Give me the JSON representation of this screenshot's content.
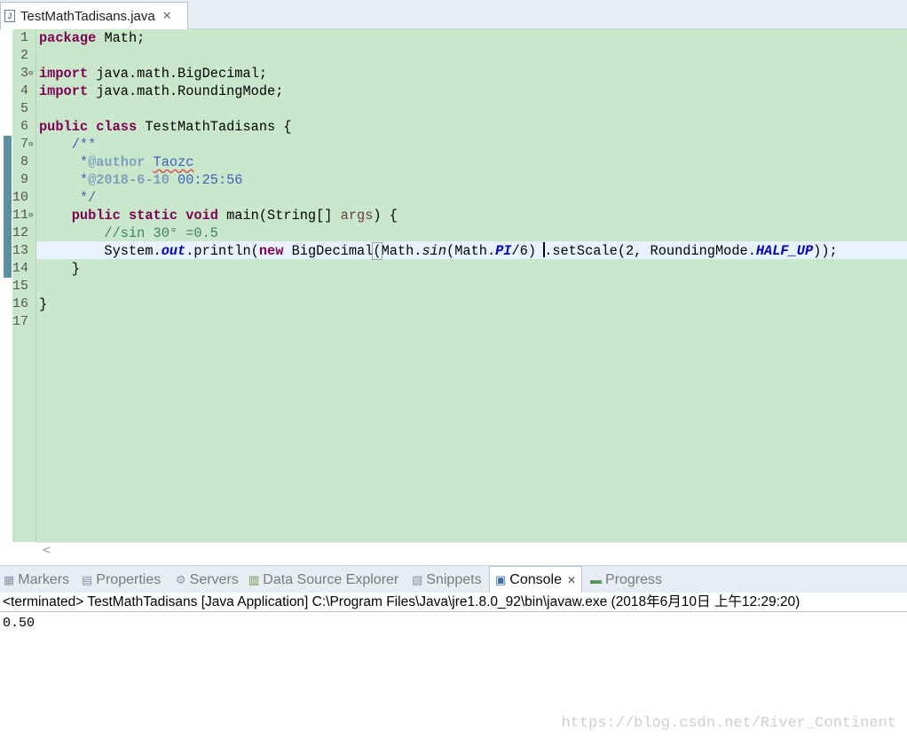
{
  "editor_tab": {
    "label": "TestMathTadisans.java",
    "icon": "java-file-icon",
    "close": "✕"
  },
  "code_lines": [
    {
      "n": "1"
    },
    {
      "n": "2"
    },
    {
      "n": "3"
    },
    {
      "n": "4"
    },
    {
      "n": "5"
    },
    {
      "n": "6"
    },
    {
      "n": "7"
    },
    {
      "n": "8"
    },
    {
      "n": "9"
    },
    {
      "n": "10"
    },
    {
      "n": "11"
    },
    {
      "n": "12"
    },
    {
      "n": "13"
    },
    {
      "n": "14"
    },
    {
      "n": "15"
    },
    {
      "n": "16"
    },
    {
      "n": "17"
    }
  ],
  "code": {
    "l1_kw": "package",
    "l1_rest": " Math;",
    "l3_kw": "import",
    "l3_rest": " java.math.BigDecimal;",
    "l4_kw": "import",
    "l4_rest": " java.math.RoundingMode;",
    "l6_kw": "public class",
    "l6_rest": " TestMathTadisans {",
    "l7": "    /**",
    "l8_pre": "     *",
    "l8_tag": "@author",
    "l8_sp": " ",
    "l8_name": "Taozc",
    "l9_pre": "     *",
    "l9_tag": "@2018-6-10",
    "l9_rest": " 00:25:56",
    "l10": "     */",
    "l11_kw": "    public static void",
    "l11_mid": " main(String[] ",
    "l11_param": "args",
    "l11_end": ") {",
    "l12": "        //sin 30° =0.5",
    "l13_a": "        System.",
    "l13_out": "out",
    "l13_b": ".println(",
    "l13_new": "new",
    "l13_c": " BigDecimal",
    "l13_paren": "(",
    "l13_d": "Math.",
    "l13_sin": "sin",
    "l13_e": "(Math.",
    "l13_pi": "PI",
    "l13_f": "/6) ",
    "l13_g": ".setScale(2, RoundingMode.",
    "l13_half": "HALF_UP",
    "l13_h": "));",
    "l14": "    }",
    "l16": "}"
  },
  "panel_tabs": [
    {
      "label": "Markers",
      "icon": "markers-icon"
    },
    {
      "label": "Properties",
      "icon": "properties-icon"
    },
    {
      "label": "Servers",
      "icon": "servers-icon"
    },
    {
      "label": "Data Source Explorer",
      "icon": "data-source-icon"
    },
    {
      "label": "Snippets",
      "icon": "snippets-icon"
    },
    {
      "label": "Console",
      "icon": "console-icon",
      "active": true
    },
    {
      "label": "Progress",
      "icon": "progress-icon"
    }
  ],
  "console": {
    "header": "<terminated> TestMathTadisans [Java Application] C:\\Program Files\\Java\\jre1.8.0_92\\bin\\javaw.exe (2018年6月10日 上午12:29:20)",
    "output": "0.50"
  },
  "watermark": "https://blog.csdn.net/River_Continent",
  "colors": {
    "editor_bg": "#c9e8cb",
    "keyword": "#7f0055",
    "comment": "#3f7f5f",
    "javadoc": "#3f5fbf",
    "field": "#0000c0"
  }
}
